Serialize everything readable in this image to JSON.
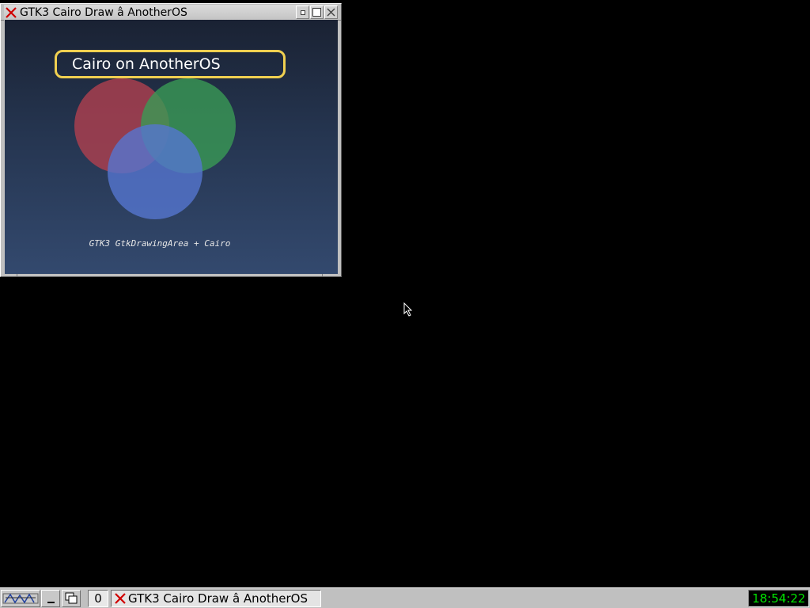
{
  "window": {
    "title": "GTK3 Cairo Draw â AnotherOS",
    "app_icon": "x-close-icon",
    "buttons": [
      "minimize-icon",
      "maximize-icon",
      "close-icon"
    ]
  },
  "canvas": {
    "banner_text": "Cairo on AnotherOS",
    "caption": "GTK3 GtkDrawingArea + Cairo",
    "colors": {
      "banner_border": "#f0d050",
      "circle_red": "#b0404f",
      "circle_green": "#3a9a55",
      "circle_blue": "#5575d0",
      "background_top": "#1a2233",
      "background_bottom": "#33496e"
    }
  },
  "taskbar": {
    "start_icon": "icewm-logo-icon",
    "show_desktop_icon": "show-desktop-icon",
    "window_list_icon": "window-list-icon",
    "workspace": "0",
    "task_label": "GTK3 Cairo Draw â AnotherOS",
    "clock": "18:54:22",
    "clock_color": "#00e000"
  }
}
